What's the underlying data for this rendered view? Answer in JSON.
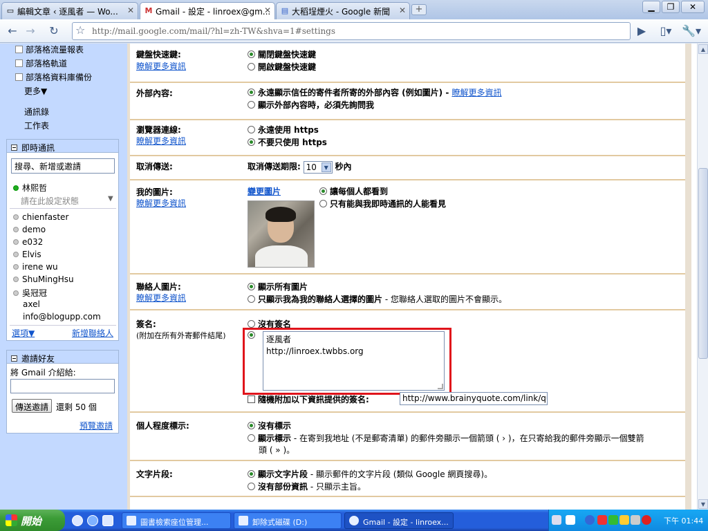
{
  "browser": {
    "tabs": [
      {
        "title": "編輯文章 ‹ 逐風者 — Wo...",
        "icon": "page-icon"
      },
      {
        "title": "Gmail - 設定 - linroex@gm...",
        "icon": "gmail-icon",
        "active": true
      },
      {
        "title": "大稻埕煙火 - Google 新聞",
        "icon": "news-icon"
      }
    ],
    "url": "http://mail.google.com/mail/?hl=zh-TW&shva=1#settings"
  },
  "sidebar": {
    "labels": [
      "部落格流量報表",
      "部落格軌道",
      "部落格資料庫備份"
    ],
    "more": "更多▼",
    "links": [
      "通訊錄",
      "工作表"
    ],
    "chat": {
      "title": "即時通訊",
      "search_value": "搜尋、新增或邀請",
      "self_name": "林熙哲",
      "status_prompt": "請在此設定狀態",
      "contacts": [
        "chienfaster",
        "demo",
        "e032",
        "Elvis",
        "irene wu",
        "ShuMingHsu",
        "吳冠冠",
        "axel",
        "info@blogupp.com"
      ],
      "options": "選項▼",
      "add_contact": "新增聯絡人"
    },
    "invite": {
      "title": "邀請好友",
      "intro": "將 Gmail 介紹給:",
      "send_button": "傳送邀請",
      "remaining": "還剩 50 個",
      "preview": "預覽邀請"
    }
  },
  "settings": {
    "learn_more": "瞭解更多資訊",
    "shortcuts": {
      "label": "鍵盤快速鍵:",
      "opt_off": "關閉鍵盤快速鍵",
      "opt_on": "開啟鍵盤快速鍵"
    },
    "external": {
      "label": "外部內容:",
      "opt_always": "永遠顯示信任的寄件者所寄的外部內容 (例如圖片) - ",
      "opt_ask": "顯示外部內容時，必須先詢問我"
    },
    "connection": {
      "label": "瀏覽器連線:",
      "opt_always": "永遠使用 https",
      "opt_never": "不要只使用 https"
    },
    "undo_send": {
      "label": "取消傳送:",
      "period_label": "取消傳送期限:",
      "value": "10",
      "unit": "秒內"
    },
    "my_picture": {
      "label": "我的圖片:",
      "change": "變更圖片",
      "opt_everyone": "讓每個人都看到",
      "opt_chat_only": "只有能與我即時通訊的人能看見"
    },
    "contact_pictures": {
      "label": "聯絡人圖片:",
      "opt_all": "顯示所有圖片",
      "opt_mine": "只顯示我為我的聯絡人選擇的圖片",
      "opt_mine_note": " - 您聯絡人選取的圖片不會顯示。"
    },
    "signature": {
      "label": "簽名:",
      "sublabel": "(附加在所有外寄郵件結尾)",
      "opt_none": "沒有簽名",
      "text_line1": "逐風者",
      "text_line2": "http://linroex.twbbs.org",
      "random_label": "隨機附加以下資訊提供的簽名:",
      "random_url": "http://www.brainyquote.com/link/quo"
    },
    "personal_indicators": {
      "label": "個人程度標示:",
      "opt_none": "沒有標示",
      "opt_show": "顯示標示",
      "opt_show_note": " - 在寄到我地址 (不是郵寄清單) 的郵件旁顯示一個箭頭 ( › )，在只寄給我的郵件旁顯示一個雙箭",
      "opt_show_note2": "頭 ( » )。"
    },
    "snippets": {
      "label": "文字片段:",
      "opt_show": "顯示文字片段",
      "opt_show_note": " - 顯示郵件的文字片段 (類似 Google 網頁搜尋)。",
      "opt_none": "沒有部份資訊",
      "opt_none_note": " - 只顯示主旨。"
    }
  },
  "taskbar": {
    "start": "開始",
    "tasks": [
      "圖書檢索座位管理...",
      "卸除式磁碟 (D:)",
      "Gmail - 設定 - linroex..."
    ],
    "clock": "下午 01:44"
  },
  "colors": {
    "highlight": "#e0141b",
    "link": "#1155cc",
    "section_border": "#e2c9a0",
    "sidebar_bg": "#c3d9ff"
  }
}
